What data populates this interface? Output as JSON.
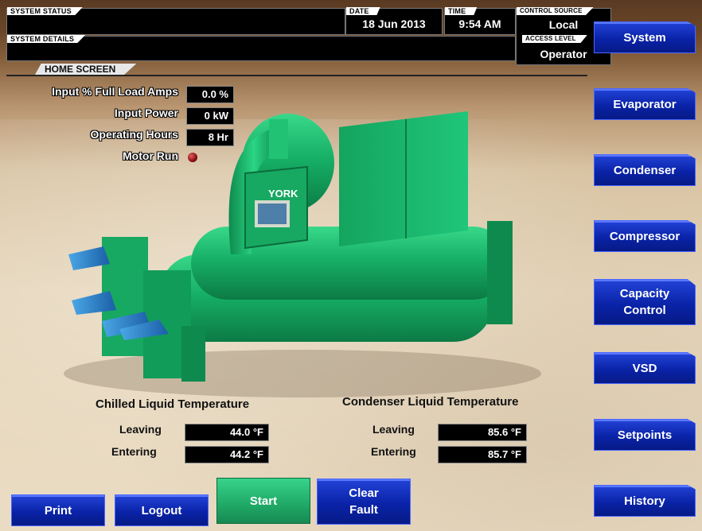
{
  "header": {
    "system_status_label": "SYSTEM STATUS",
    "system_status_value": "",
    "system_details_label": "SYSTEM DETAILS",
    "system_details_value": "",
    "date_label": "DATE",
    "date_value": "18 Jun 2013",
    "time_label": "TIME",
    "time_value": "9:54 AM",
    "control_source_label": "CONTROL SOURCE",
    "control_source_value": "Local",
    "access_level_label": "ACCESS LEVEL",
    "access_level_value": "Operator"
  },
  "screen_tab": "HOME SCREEN",
  "readouts": [
    {
      "label": "Input % Full Load Amps",
      "value": "0.0 %"
    },
    {
      "label": "Input Power",
      "value": "0 kW"
    },
    {
      "label": "Operating Hours",
      "value": "8 Hr"
    }
  ],
  "motor_run": {
    "label": "Motor Run",
    "color": "#8b0d12"
  },
  "chiller_logo": "YORK",
  "chilled": {
    "title": "Chilled Liquid Temperature",
    "leaving_label": "Leaving",
    "leaving_value": "44.0 °F",
    "entering_label": "Entering",
    "entering_value": "44.2 °F"
  },
  "condenser": {
    "title": "Condenser Liquid Temperature",
    "leaving_label": "Leaving",
    "leaving_value": "85.6 °F",
    "entering_label": "Entering",
    "entering_value": "85.7 °F"
  },
  "nav": [
    {
      "label": "System"
    },
    {
      "label": "Evaporator"
    },
    {
      "label": "Condenser"
    },
    {
      "label": "Compressor"
    },
    {
      "label": "Capacity Control"
    },
    {
      "label": "VSD"
    },
    {
      "label": "Setpoints"
    },
    {
      "label": "History"
    }
  ],
  "bottom": {
    "print": "Print",
    "logout": "Logout",
    "start": "Start",
    "clear_fault": "Clear Fault"
  },
  "colors": {
    "accent_blue": "#0a23a8",
    "start_green": "#1fa866",
    "chiller_green": "#19b56a"
  }
}
